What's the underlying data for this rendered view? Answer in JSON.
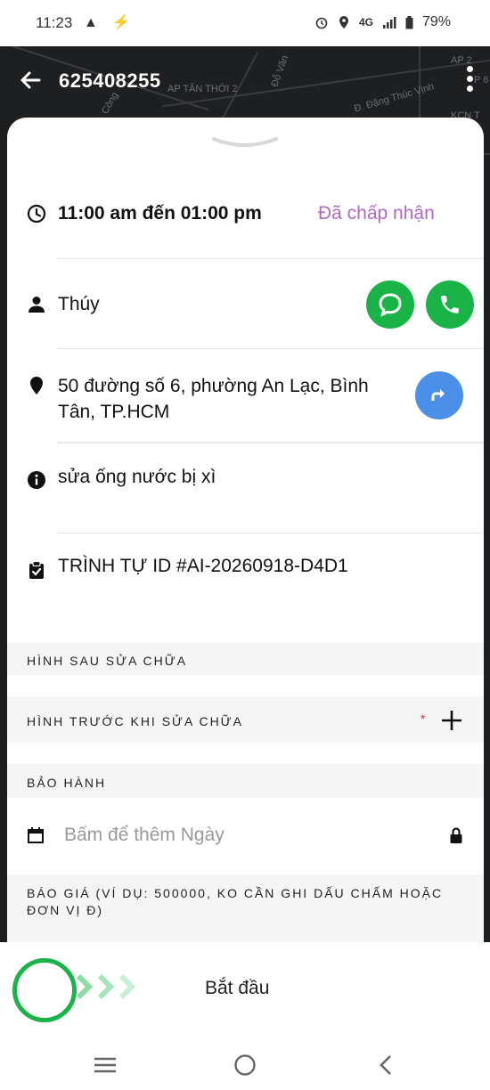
{
  "status_bar": {
    "time": "11:23",
    "left_icons": "▲ ⚡",
    "net_label": "4G",
    "battery": "79%"
  },
  "map": {
    "labels": [
      "AP TÂN THỚI 2",
      "Đ. Đặng Thúc Vịnh",
      "Đỗ Văn",
      "Đ. Công",
      "AP 2",
      "KCN T",
      "P 6"
    ]
  },
  "header": {
    "order_id": "625408255",
    "back_icon": "arrow-left-icon",
    "menu_icon": "more-vertical-icon"
  },
  "job": {
    "time_range": "11:00 am đến 01:00 pm",
    "status": "Đã chấp nhận",
    "customer_name": "Thúy",
    "address": "50 đường số 6, phường An Lạc, Bình Tân, TP.HCM",
    "description": "sửa ống nước bị xì",
    "sequence": "TRÌNH TỰ ID #AI-20260918-D4D1"
  },
  "sections": {
    "after_photos": "HÌNH SAU SỬA CHỮA",
    "before_photos": "HÌNH TRƯỚC KHI SỬA CHỮA",
    "required_mark": "*",
    "warranty": "BẢO HÀNH",
    "warranty_placeholder": "Bấm để thêm Ngày",
    "quote": "BÁO GIÁ (VÍ DỤ: 500000, KO CẦN GHI DẤU CHẤM HOẶC ĐƠN VỊ Đ)"
  },
  "actions": {
    "start_label": "Bắt đầu"
  },
  "colors": {
    "accent_purple": "#b069c8",
    "green": "#19b347",
    "blue": "#4a8fe8"
  }
}
